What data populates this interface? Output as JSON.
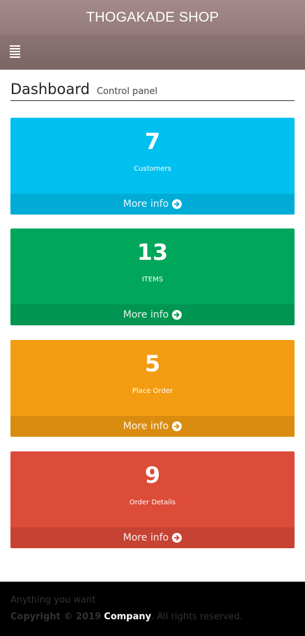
{
  "header": {
    "brand": "THOGAKADE SHOP",
    "nav_bg": "#7a6464"
  },
  "content_header": {
    "title": "Dashboard",
    "subtitle": "Control panel"
  },
  "boxes": [
    {
      "count": "7",
      "label": "Customers",
      "more": "More info",
      "color": "#00c0ef",
      "footer_color": "#00acd6",
      "icon": "arrow-circle-right-icon"
    },
    {
      "count": "13",
      "label": "ITEMS",
      "more": "More info",
      "color": "#00a65a",
      "footer_color": "#009551",
      "icon": "arrow-circle-right-icon"
    },
    {
      "count": "5",
      "label": "Place Order",
      "more": "More info",
      "color": "#f39c12",
      "footer_color": "#da8c10",
      "icon": "arrow-circle-right-icon"
    },
    {
      "count": "9",
      "label": "Order Details",
      "more": "More info",
      "color": "#dd4b39",
      "footer_color": "#c64333",
      "icon": "arrow-circle-right-icon"
    }
  ],
  "footer": {
    "tagline": "Anything you want",
    "copyright_prefix": "Copyright © 2019",
    "company": "Company",
    "rights": ". All rights reserved."
  }
}
